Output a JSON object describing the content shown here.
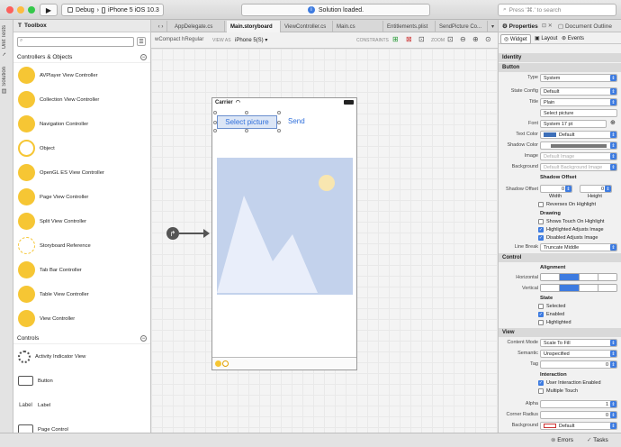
{
  "titlebar": {
    "scheme": "Debug",
    "device": "iPhone 5 iOS 10.3",
    "status": "Solution loaded.",
    "search_placeholder": "Press '⌘.' to search"
  },
  "leftstrip": {
    "unit_tests": "Unit Tests",
    "solution": "Solution"
  },
  "toolbox": {
    "title": "Toolbox",
    "sections": [
      {
        "label": "Controllers & Objects",
        "items": [
          "AVPlayer View Controller",
          "Collection View Controller",
          "Navigation Controller",
          "Object",
          "OpenGL ES View Controller",
          "Page View Controller",
          "Split View Controller",
          "Storyboard Reference",
          "Tab Bar Controller",
          "Table View Controller",
          "View Controller"
        ]
      },
      {
        "label": "Controls",
        "items": [
          "Activity Indicator View",
          "Button",
          "Label",
          "Page Control"
        ]
      }
    ],
    "label_icon_text": "Label"
  },
  "tabs": [
    "AppDelegate.cs",
    "Main.storyboard",
    "ViewController.cs",
    "Main.cs",
    "Entitlements.plist",
    "SendPicture Co..."
  ],
  "editor_toolbar": {
    "size_class": "wCompact hRegular",
    "view_as_label": "VIEW AS",
    "view_as_value": "iPhone 5(S)",
    "constraints_label": "CONSTRAINTS",
    "zoom_label": "ZOOM"
  },
  "phone": {
    "carrier": "Carrier",
    "select_button": "Select picture",
    "send_button": "Send"
  },
  "properties": {
    "header": "Properties",
    "doc_outline": "Document Outline",
    "tabs": [
      "Widget",
      "Layout",
      "Events"
    ],
    "sections": {
      "identity": "Identity",
      "button": "Button",
      "control": "Control",
      "view": "View"
    },
    "fields": {
      "type_label": "Type",
      "type_value": "System",
      "state_label": "State Config",
      "state_value": "Default",
      "title_label": "Title",
      "title_value": "Plain",
      "title_text": "Select picture",
      "font_label": "Font",
      "font_value": "System 17 pt",
      "text_color_label": "Text Color",
      "text_color_value": "Default",
      "shadow_color_label": "Shadow Color",
      "image_label": "Image",
      "image_value": "Default Image",
      "background_label": "Background",
      "background_value": "Default Background Image",
      "shadow_offset_header": "Shadow Offset",
      "shadow_offset_label": "Shadow Offset",
      "shadow_w": "0",
      "shadow_h": "0",
      "width_label": "Width",
      "height_label": "Height",
      "reverses": "Reverses On Highlight",
      "drawing_header": "Drawing",
      "shows_touch": "Shows Touch On Highlight",
      "highlighted_adjusts": "Highlighted Adjusts Image",
      "disabled_adjusts": "Disabled Adjusts Image",
      "line_break_label": "Line Break",
      "line_break_value": "Truncate Middle",
      "alignment_header": "Alignment",
      "horizontal_label": "Horizontal",
      "vertical_label": "Vertical",
      "state_header": "State",
      "selected": "Selected",
      "enabled": "Enabled",
      "highlighted": "Highlighted",
      "content_mode_label": "Content Mode",
      "content_mode_value": "Scale To Fill",
      "semantic_label": "Semantic",
      "semantic_value": "Unspecified",
      "tag_label": "Tag",
      "tag_value": "0",
      "interaction_header": "Interaction",
      "user_interaction": "User Interaction Enabled",
      "multiple_touch": "Multiple Touch",
      "alpha_label": "Alpha",
      "alpha_value": "1",
      "corner_label": "Corner Radius",
      "corner_value": "0",
      "view_bg_label": "Background",
      "view_bg_value": "Default"
    }
  },
  "bottombar": {
    "errors": "Errors",
    "tasks": "Tasks"
  },
  "colors": {
    "accent": "#3d7be0",
    "toolbox_icon": "#f6c634",
    "image_placeholder": "#c3d2ec",
    "sun": "#f8e6b0"
  }
}
